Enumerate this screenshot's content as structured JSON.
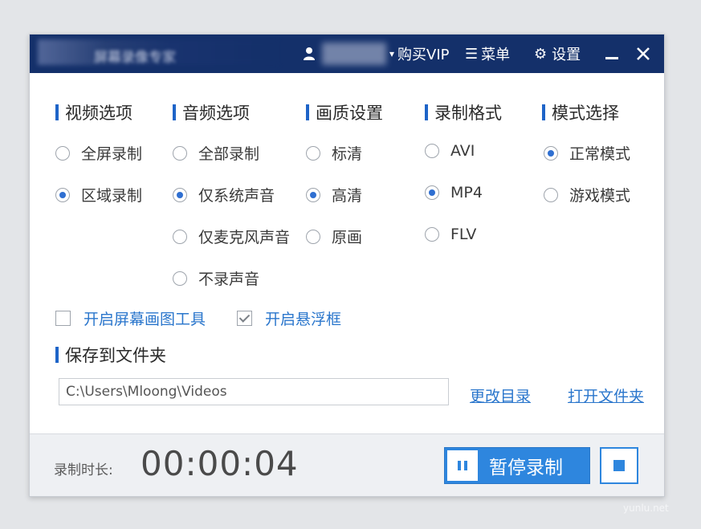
{
  "titlebar": {
    "app_title": "屏幕录像专家",
    "user_name": "",
    "vip_label": "购买VIP",
    "menu_label": "菜单",
    "settings_label": "设置",
    "minimize_icon": "minimize-icon",
    "close_icon": "close-icon"
  },
  "sections": {
    "video": {
      "title": "视频选项",
      "options": [
        {
          "label": "全屏录制",
          "checked": false
        },
        {
          "label": "区域录制",
          "checked": true
        }
      ]
    },
    "audio": {
      "title": "音频选项",
      "options": [
        {
          "label": "全部录制",
          "checked": false
        },
        {
          "label": "仅系统声音",
          "checked": true
        },
        {
          "label": "仅麦克风声音",
          "checked": false
        },
        {
          "label": "不录声音",
          "checked": false
        }
      ]
    },
    "quality": {
      "title": "画质设置",
      "options": [
        {
          "label": "标清",
          "checked": false
        },
        {
          "label": "高清",
          "checked": true
        },
        {
          "label": "原画",
          "checked": false
        }
      ]
    },
    "format": {
      "title": "录制格式",
      "options": [
        {
          "label": "AVI",
          "checked": false
        },
        {
          "label": "MP4",
          "checked": true
        },
        {
          "label": "FLV",
          "checked": false
        }
      ]
    },
    "mode": {
      "title": "模式选择",
      "options": [
        {
          "label": "正常模式",
          "checked": true
        },
        {
          "label": "游戏模式",
          "checked": false
        }
      ]
    }
  },
  "checkboxes": {
    "draw_tool": {
      "label": "开启屏幕画图工具",
      "checked": false
    },
    "float_window": {
      "label": "开启悬浮框",
      "checked": true
    }
  },
  "save_folder": {
    "title": "保存到文件夹",
    "path": "C:\\Users\\Mloong\\Videos",
    "change_dir": "更改目录",
    "open_folder": "打开文件夹"
  },
  "footer": {
    "duration_label": "录制时长:",
    "duration_value": "00:00:04",
    "pause_label": "暂停录制"
  },
  "watermark": "yunlu.net",
  "colors": {
    "titlebar": "#14306a",
    "accent": "#2e86de",
    "link": "#2a76cc"
  }
}
